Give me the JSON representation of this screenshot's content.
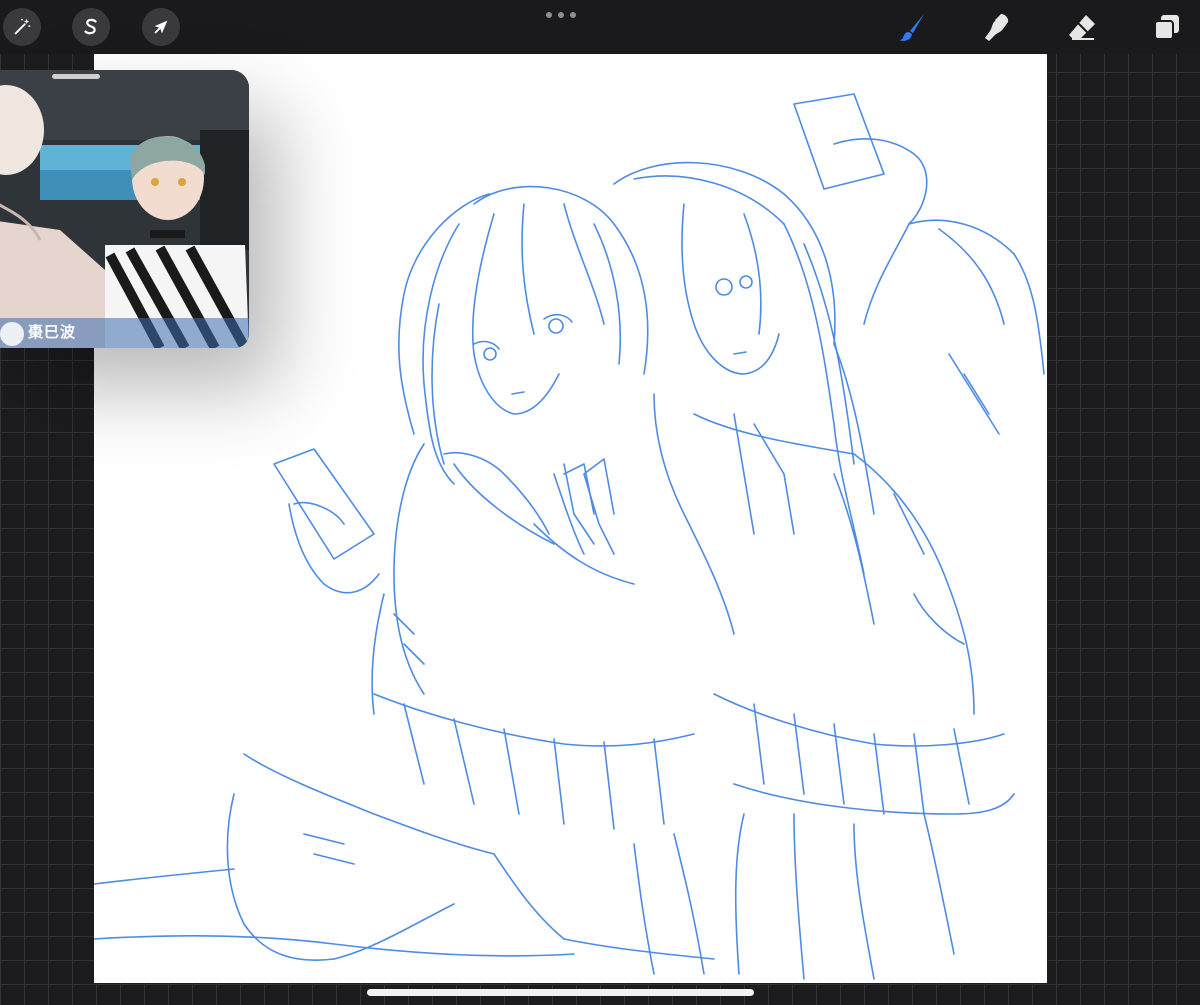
{
  "toolbar": {
    "left_tools": [
      {
        "name": "adjustments",
        "icon": "magic-wand-icon"
      },
      {
        "name": "selection",
        "icon": "selection-s-icon"
      },
      {
        "name": "transform",
        "icon": "arrow-cursor-icon"
      }
    ],
    "more_icon": "ellipsis-icon",
    "right_tools": [
      {
        "name": "brush",
        "icon": "brush-icon",
        "active": true
      },
      {
        "name": "smudge",
        "icon": "smudge-finger-icon"
      },
      {
        "name": "eraser",
        "icon": "eraser-icon"
      },
      {
        "name": "layers",
        "icon": "layers-icon"
      }
    ]
  },
  "colors": {
    "active_tool": "#2f7bf6",
    "sketch_stroke": "#3b7fe0",
    "toolbar_bg": "#1a1a1c",
    "canvas_bg": "#ffffff"
  },
  "reference_window": {
    "caption": "棗巳波"
  },
  "canvas": {
    "content": "sketch"
  }
}
